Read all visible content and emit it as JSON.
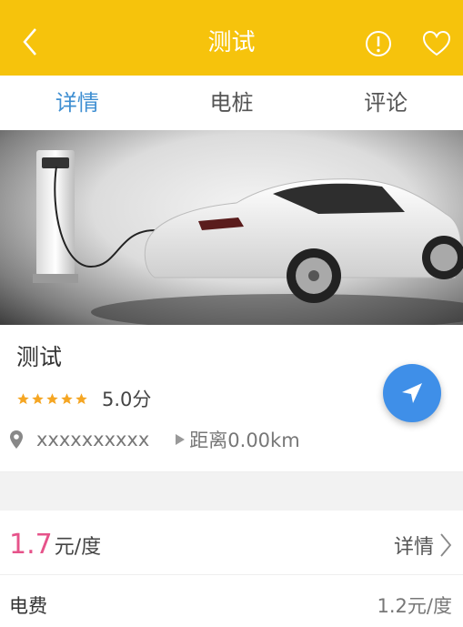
{
  "header": {
    "title": "测试",
    "back_icon": "chevron-left-icon",
    "report_icon": "alert-circle-icon",
    "favorite_icon": "heart-outline-icon",
    "bg_color": "#f6c30c"
  },
  "tabs": [
    {
      "label": "详情",
      "active": true
    },
    {
      "label": "电桩",
      "active": false
    },
    {
      "label": "评论",
      "active": false
    }
  ],
  "station": {
    "name": "测试",
    "rating_stars": 5,
    "rating_text": "5.0分",
    "address": "xxxxxxxxxx",
    "distance": "距离0.00km"
  },
  "pricing": {
    "price_number": "1.7",
    "price_unit": "元/度",
    "detail_label": "详情",
    "fee_label": "电费",
    "fee_value": "1.2元/度"
  },
  "colors": {
    "accent_blue": "#3f8fd2",
    "price_pink": "#e6538a",
    "star": "#f5a623"
  }
}
